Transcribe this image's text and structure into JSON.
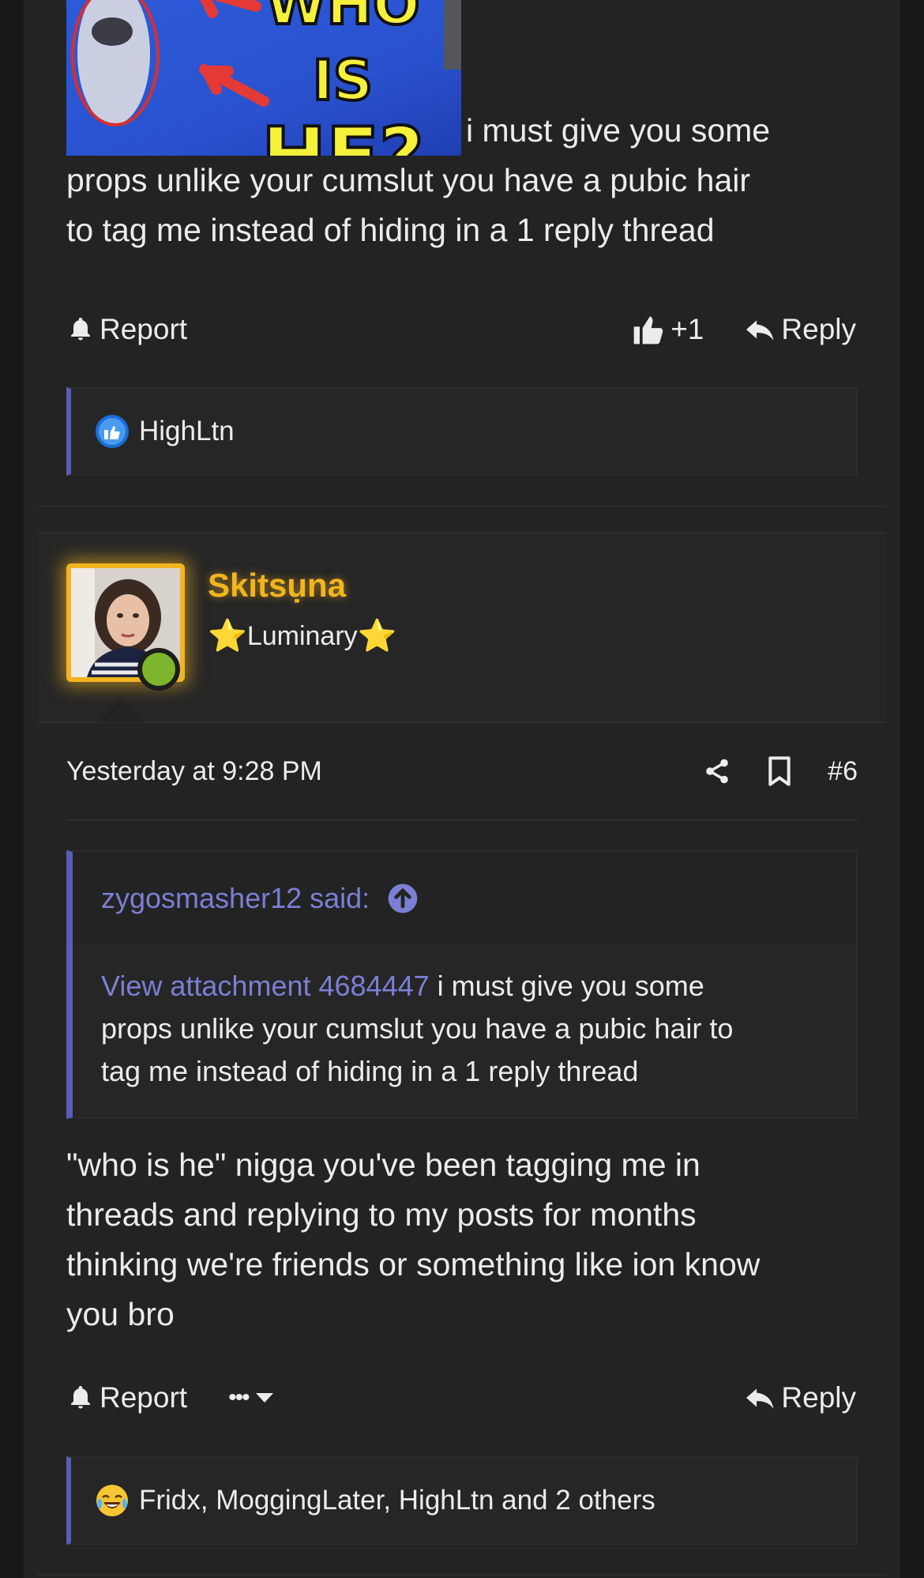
{
  "post1": {
    "attachment_thumbnail": {
      "line1": "WHO IS",
      "line2": "HE?"
    },
    "text_lines": [
      "i must give you some",
      "props unlike your cumslut you have a pubic hair",
      "to tag me instead of hiding in a 1 reply thread"
    ],
    "actions": {
      "report_label": "Report",
      "like_count": "+1",
      "reply_label": "Reply"
    },
    "reactions": {
      "emoji": "like-icon",
      "users": "HighLtn"
    }
  },
  "post2": {
    "user": {
      "name": "Skitsụna",
      "title": "Luminary",
      "status_color": "#7db52c",
      "name_color": "#f2b41f"
    },
    "timestamp": "Yesterday at 9:28 PM",
    "post_number": "#6",
    "quote": {
      "author": "zygosmasher12 said:",
      "attachment_link": "View attachment 4684447",
      "text_lines": [
        "i must give you some",
        "props unlike your cumslut you have a pubic hair to",
        "tag me instead of hiding in a 1 reply thread"
      ]
    },
    "text_lines": [
      "\"who is he\" nigga you've been tagging me in",
      "threads and replying to my posts for months",
      "thinking we're friends or something like ion know",
      "you bro"
    ],
    "actions": {
      "report_label": "Report",
      "more_label": "•••",
      "reply_label": "Reply"
    },
    "reactions": {
      "emoji": "crying-laughing-icon",
      "users": "Fridx, MoggingLater, HighLtn and 2 others"
    }
  },
  "colors": {
    "accent": "#5a5cb8",
    "link": "#7b7fd4",
    "background": "#232323"
  }
}
